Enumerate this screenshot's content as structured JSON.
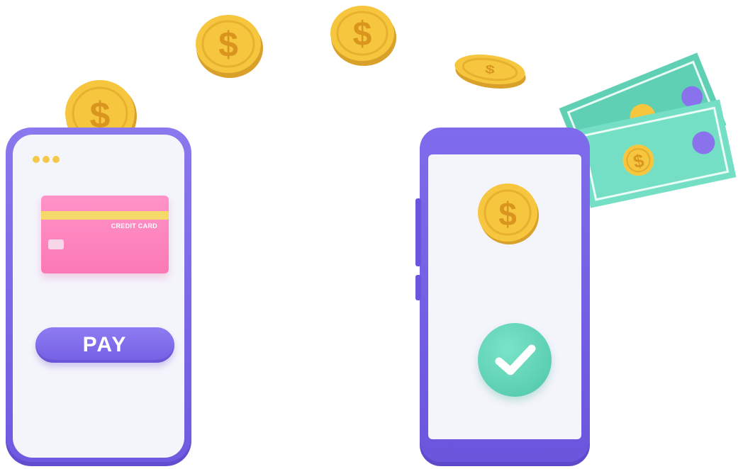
{
  "left_phone": {
    "card_label": "CREDIT CARD",
    "pay_button_label": "PAY"
  },
  "colors": {
    "phone_purple": "#7462e4",
    "screen": "#f4f4fb",
    "card_pink": "#fb84bf",
    "card_stripe": "#f5d96a",
    "coin_gold": "#f6c63f",
    "coin_symbol": "#d9951e",
    "cash_green": "#6fdcc1",
    "cash_dot": "#8a72ec",
    "check_green": "#5ccfb1"
  },
  "icons": [
    "dollar-coin-icon",
    "cash-bill-icon",
    "checkmark-icon",
    "window-dots-icon",
    "card-chip-icon"
  ]
}
